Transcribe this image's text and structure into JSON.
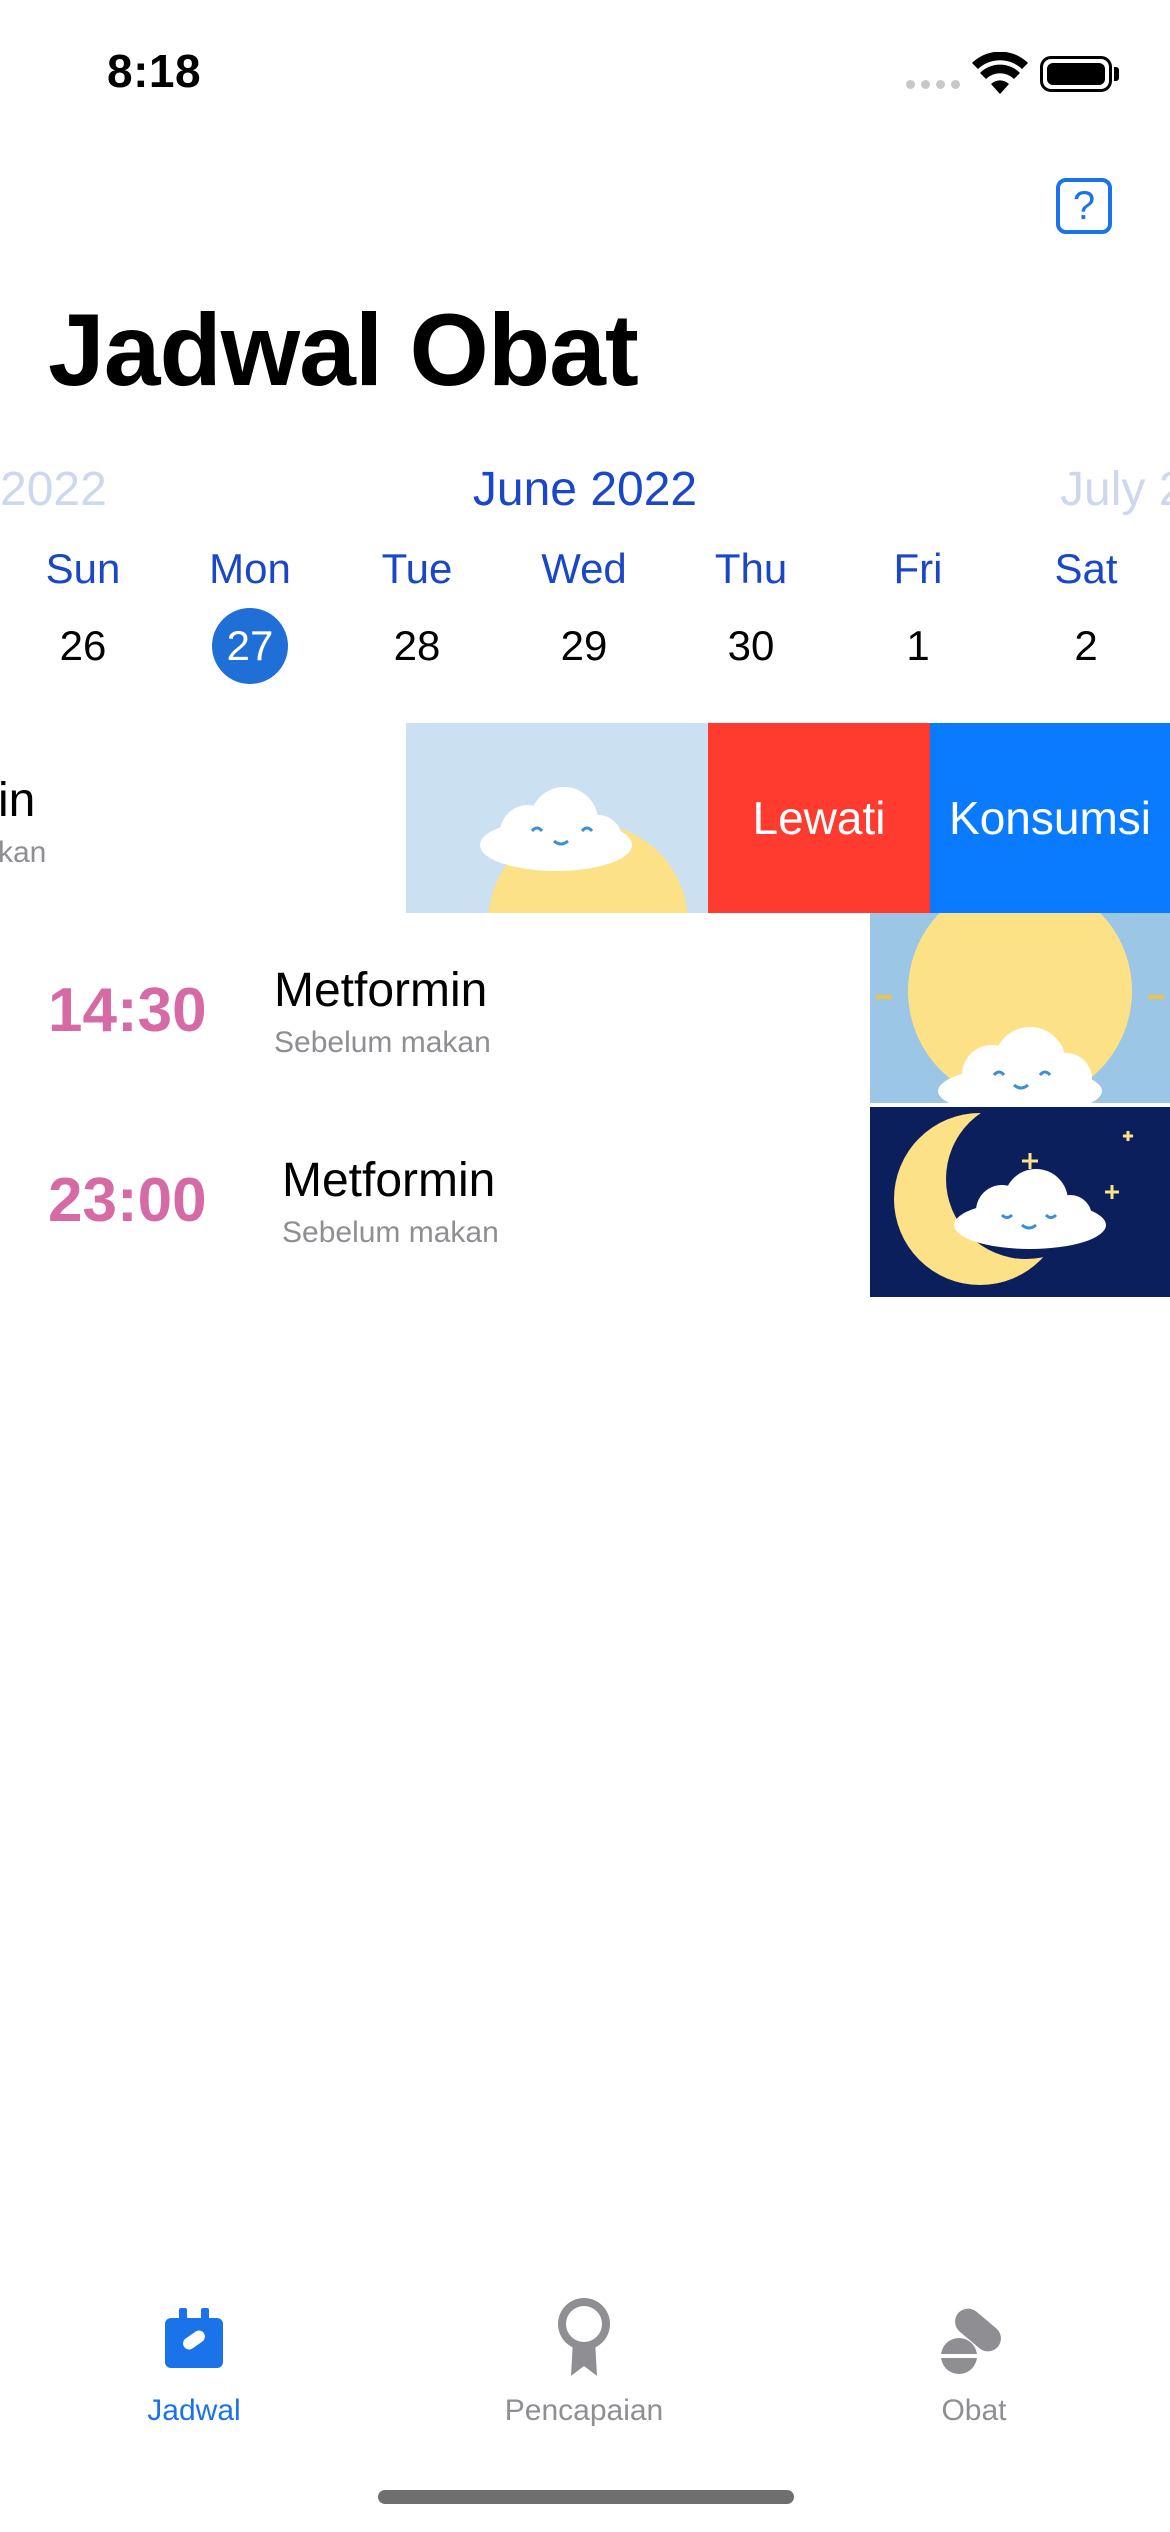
{
  "status_bar": {
    "time": "8:18"
  },
  "header": {
    "title": "Jadwal Obat",
    "help_label": "?"
  },
  "calendar": {
    "prev_month": "2022",
    "current_month": "June 2022",
    "next_month": "July 2",
    "weekdays": [
      "Sun",
      "Mon",
      "Tue",
      "Wed",
      "Thu",
      "Fri",
      "Sat"
    ],
    "days": [
      "26",
      "27",
      "28",
      "29",
      "30",
      "1",
      "2"
    ],
    "selected_day": "27"
  },
  "schedule": {
    "swiped_row": {
      "name_fragment": "in",
      "note_fragment": "kan"
    },
    "actions": {
      "skip": "Lewati",
      "consume": "Konsumsi"
    },
    "rows": [
      {
        "time": "14:30",
        "name": "Metformin",
        "note": "Sebelum makan"
      },
      {
        "time": "23:00",
        "name": "Metformin",
        "note": "Sebelum makan"
      }
    ]
  },
  "tabbar": {
    "tabs": [
      {
        "label": "Jadwal",
        "active": true
      },
      {
        "label": "Pencapaian",
        "active": false
      },
      {
        "label": "Obat",
        "active": false
      }
    ]
  },
  "colors": {
    "accent": "#1a73e8",
    "month": "#1a47c8",
    "time": "#d66aa4",
    "skip": "#ff3b30",
    "consume": "#0a7aff",
    "night": "#0b1f5c"
  }
}
